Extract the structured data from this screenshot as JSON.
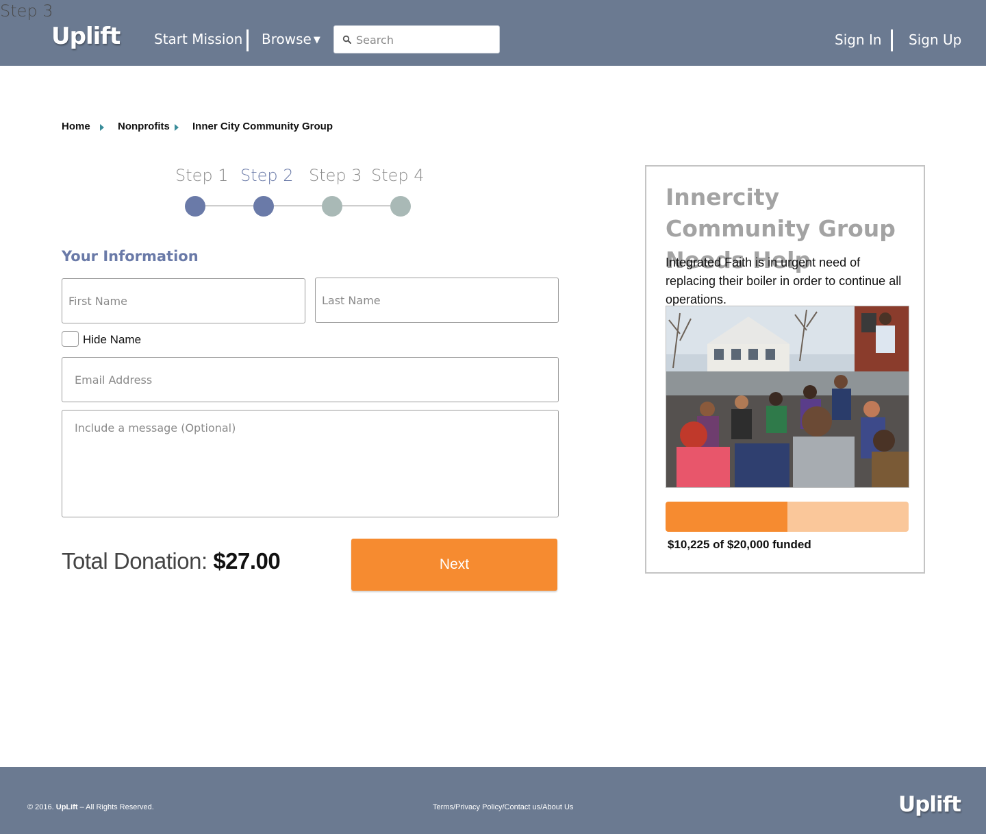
{
  "frame_label": "Step 3",
  "header": {
    "logo": "Uplift",
    "nav": {
      "start_mission": "Start Mission",
      "browse": "Browse"
    },
    "search": {
      "placeholder": "Search"
    },
    "auth": {
      "sign_in": "Sign In",
      "sign_up": "Sign Up"
    }
  },
  "breadcrumb": [
    "Home",
    "Nonprofits",
    "Inner City Community Group"
  ],
  "steps": {
    "labels": [
      "Step 1",
      "Step 2",
      "Step 3",
      "Step 4"
    ],
    "current": 2,
    "completed": 2
  },
  "form": {
    "section_title": "Your Information",
    "first_name": {
      "placeholder": "First Name",
      "value": ""
    },
    "last_name": {
      "placeholder": "Last Name",
      "value": ""
    },
    "hide_name": {
      "label": "Hide Name",
      "checked": false
    },
    "email": {
      "placeholder": "Email Address",
      "value": ""
    },
    "message": {
      "placeholder": "Include a message (Optional)",
      "value": ""
    },
    "total_label": "Total Donation:",
    "total_amount": "$27.00",
    "next_label": "Next"
  },
  "campaign": {
    "title": "Innercity Community Group Needs Help",
    "description": "Integrated Faith is in urgent need of replacing their boiler in order to continue all operations.",
    "progress_fraction": 0.5,
    "funded_text": "$10,225 of $20,000 funded"
  },
  "footer": {
    "copyright_prefix": "© 2016.",
    "copyright_brand": "UpLift",
    "copyright_suffix": "– All Rights Reserved.",
    "links": "Terms/Privacy Policy/Contact us/About Us",
    "logo": "Uplift"
  },
  "colors": {
    "header_bg": "#6b7a91",
    "accent_blue": "#6a7aa8",
    "step_todo": "#a9b9b6",
    "orange": "#f68b30",
    "orange_light": "#fac79a"
  }
}
